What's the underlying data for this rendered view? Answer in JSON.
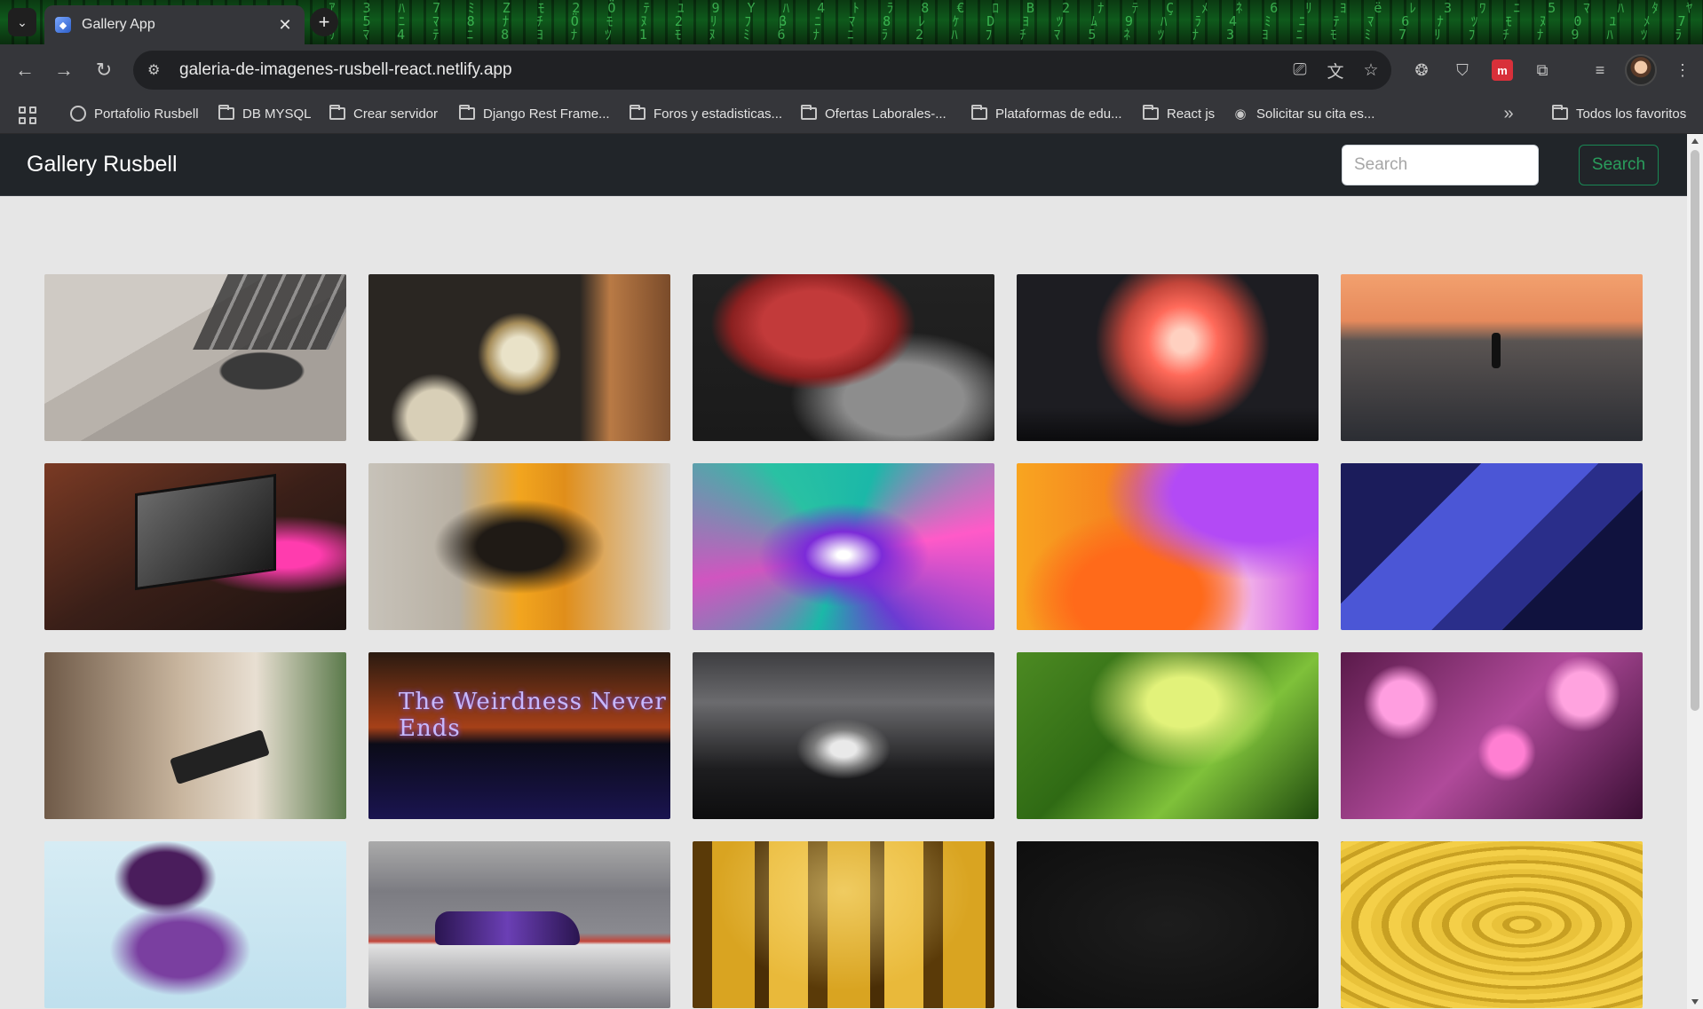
{
  "browser": {
    "tab": {
      "title": "Gallery App"
    },
    "address": {
      "url": "galeria-de-imagenes-rusbell-react.netlify.app"
    },
    "bookmarks": [
      {
        "label": "Portafolio Rusbell",
        "icon": "globe-icon"
      },
      {
        "label": "DB MYSQL",
        "icon": "folder-icon"
      },
      {
        "label": "Crear servidor",
        "icon": "folder-icon"
      },
      {
        "label": "Django Rest Frame...",
        "icon": "folder-icon"
      },
      {
        "label": "Foros y estadisticas...",
        "icon": "folder-icon"
      },
      {
        "label": "Ofertas Laborales-...",
        "icon": "folder-icon"
      },
      {
        "label": "Plataformas de edu...",
        "icon": "folder-icon"
      },
      {
        "label": "React js",
        "icon": "folder-icon"
      },
      {
        "label": "Solicitar su cita es...",
        "icon": "seal-icon"
      }
    ],
    "all_bookmarks": "Todos los favoritos"
  },
  "app": {
    "brand": "Gallery Rusbell",
    "search": {
      "placeholder": "Search",
      "button_label": "Search"
    }
  }
}
